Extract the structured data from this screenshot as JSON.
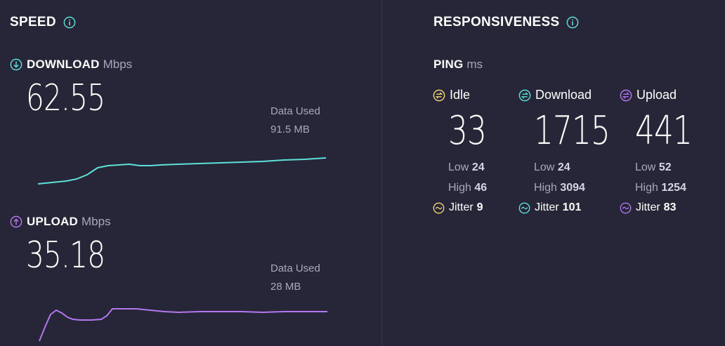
{
  "speed": {
    "title": "SPEED",
    "download": {
      "label": "DOWNLOAD",
      "unit": "Mbps",
      "value": "62.55",
      "data_used_label": "Data Used",
      "data_used_value": "91.5 MB",
      "color": "#5ee0d8"
    },
    "upload": {
      "label": "UPLOAD",
      "unit": "Mbps",
      "value": "35.18",
      "data_used_label": "Data Used",
      "data_used_value": "28 MB",
      "color": "#b377f0"
    }
  },
  "responsiveness": {
    "title": "RESPONSIVENESS",
    "ping_label": "PING",
    "ping_unit": "ms",
    "columns": [
      {
        "label": "Idle",
        "value": "33",
        "low_label": "Low",
        "low": "24",
        "high_label": "High",
        "high": "46",
        "jitter_label": "Jitter",
        "jitter": "9",
        "color": "#f2d27a"
      },
      {
        "label": "Download",
        "value": "1715",
        "low_label": "Low",
        "low": "24",
        "high_label": "High",
        "high": "3094",
        "jitter_label": "Jitter",
        "jitter": "101",
        "color": "#5ee0d8"
      },
      {
        "label": "Upload",
        "value": "441",
        "low_label": "Low",
        "low": "52",
        "high_label": "High",
        "high": "1254",
        "jitter_label": "Jitter",
        "jitter": "83",
        "color": "#b377f0"
      }
    ]
  },
  "icons": {
    "info": "info-icon",
    "download": "arrow-down-circle-icon",
    "upload": "arrow-up-circle-icon",
    "ping": "ping-circle-icon",
    "jitter": "wave-circle-icon"
  }
}
